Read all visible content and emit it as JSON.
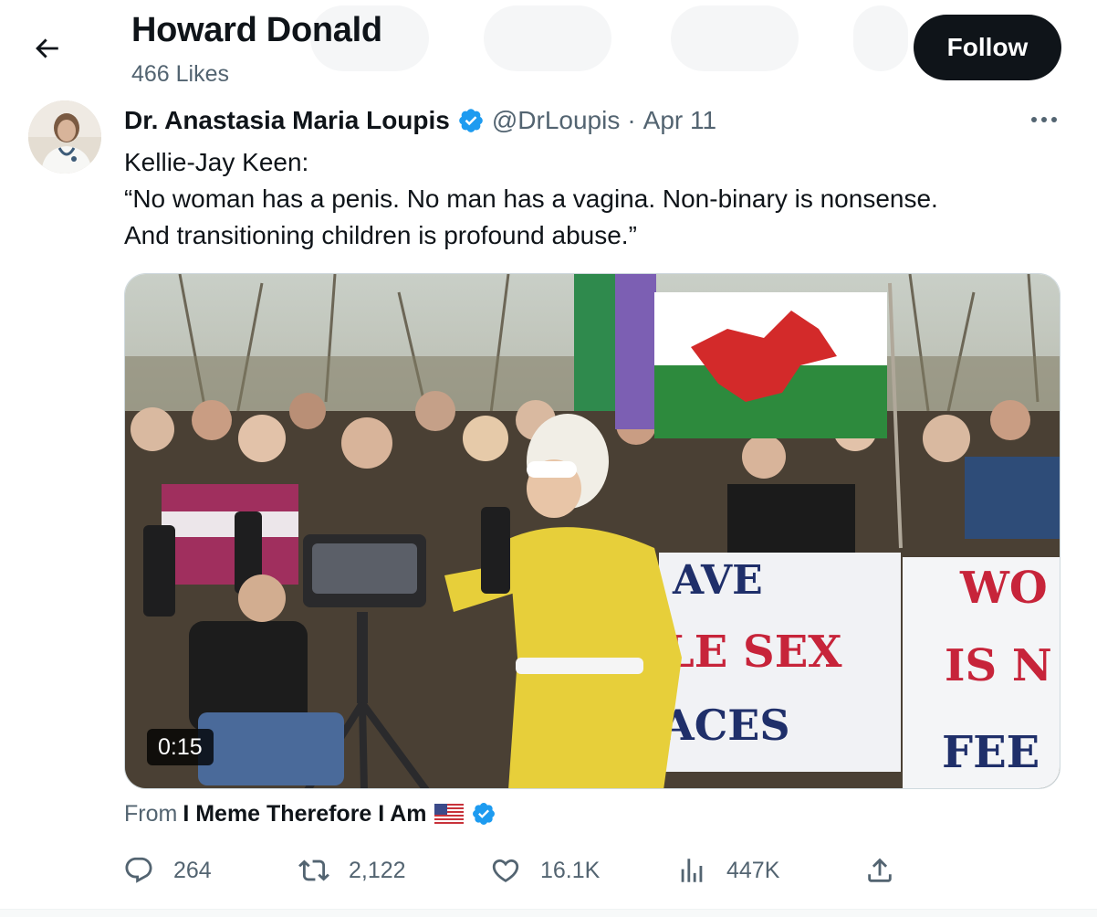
{
  "header": {
    "back_icon": "arrow-left-icon",
    "title": "Howard Donald",
    "subtitle": "466 Likes",
    "follow_label": "Follow"
  },
  "tweet": {
    "author": {
      "name": "Dr. Anastasia Maria Loupis",
      "handle": "@DrLoupis",
      "separator": "·",
      "date": "Apr 11",
      "verified_icon": "verified-badge-icon",
      "avatar_icon": "avatar-photo"
    },
    "more_icon": "more-horizontal-icon",
    "text_lines": [
      "Kellie-Jay Keen:",
      "“No woman has a penis. No man has a vagina. Non-binary is nonsense.",
      "And transitioning children is profound abuse.”"
    ],
    "media": {
      "type": "video",
      "duration": "0:15",
      "sign_texts": [
        "AVE",
        "LE SEX",
        "ACES",
        "WO",
        "IS N",
        "FEE"
      ]
    },
    "source": {
      "prefix": "From",
      "name": "I Meme Therefore I Am",
      "flag_icon": "us-flag-icon",
      "verified_icon": "verified-badge-icon"
    },
    "actions": {
      "replies": {
        "icon": "reply-icon",
        "count": "264"
      },
      "reposts": {
        "icon": "repost-icon",
        "count": "2,122"
      },
      "likes": {
        "icon": "heart-icon",
        "count": "16.1K"
      },
      "views": {
        "icon": "analytics-icon",
        "count": "447K"
      },
      "share": {
        "icon": "share-icon"
      }
    }
  },
  "colors": {
    "text_primary": "#0f1419",
    "text_secondary": "#536471",
    "verified_blue": "#1d9bf0",
    "follow_bg": "#0f1419"
  }
}
